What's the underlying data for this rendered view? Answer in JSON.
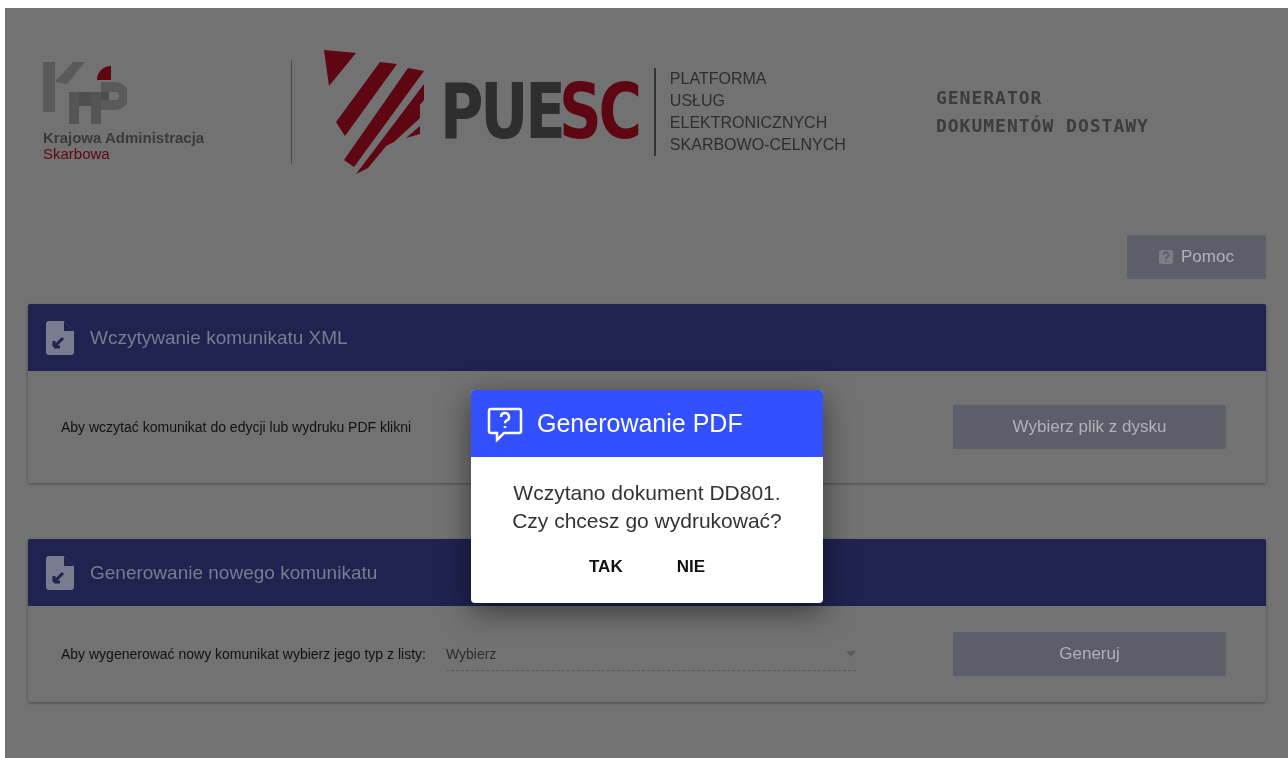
{
  "header": {
    "kas_logo": {
      "line_1": "Krajowa Administracja",
      "line_2": "Skarbowa"
    },
    "puesc_logo": {
      "wordmark": [
        {
          "text": "PUE",
          "color": "#2e2e2e"
        },
        {
          "text": "SC",
          "color": "#5e0612"
        }
      ],
      "tagline": [
        "PLATFORMA",
        "USŁUG",
        "ELEKTRONICZNYCH",
        "SKARBOWO-CELNYCH"
      ]
    },
    "app_title": [
      "GENERATOR",
      "DOKUMENTÓW DOSTAWY"
    ]
  },
  "help_button": {
    "label": "Pomoc"
  },
  "panels": [
    {
      "kind": "upload",
      "title": "Wczytywanie komunikatu XML",
      "text": "Aby wczytać komunikat do edycji lub wydruku PDF klikni",
      "button": "Wybierz plik z dysku"
    },
    {
      "kind": "generate",
      "title": "Generowanie nowego komunikatu",
      "text": "Aby wygenerować nowy komunikat wybierz jego typ z listy:",
      "select": {
        "placeholder": "Wybierz"
      },
      "button": "Generuj"
    }
  ],
  "dialog": {
    "title": "Generowanie PDF",
    "message": [
      "Wczytano dokument DD801.",
      "Czy chcesz go wydrukować?"
    ],
    "buttons": [
      "TAK",
      "NIE"
    ]
  }
}
